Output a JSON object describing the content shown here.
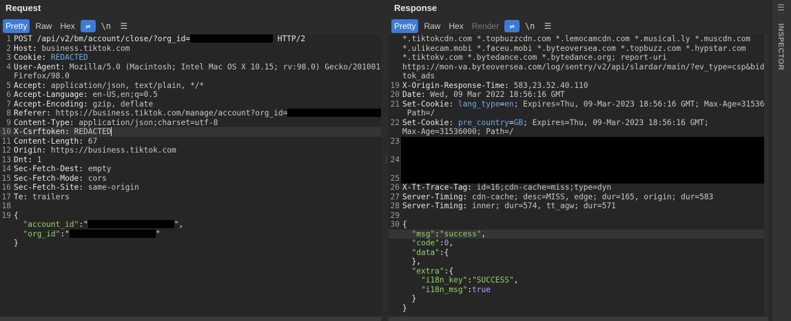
{
  "request": {
    "title": "Request",
    "tabs": [
      "Pretty",
      "Raw",
      "Hex"
    ],
    "newline_label": "\\n",
    "lines": [
      {
        "n": "1",
        "parts": [
          [
            "k",
            "POST /api/v2/bm/account/close/?org_id="
          ],
          [
            "redact",
            "120"
          ],
          [
            "k",
            " HTTP/2"
          ]
        ]
      },
      {
        "n": "2",
        "parts": [
          [
            "k",
            "Host: "
          ],
          [
            "v",
            "business.tiktok.com"
          ]
        ]
      },
      {
        "n": "3",
        "parts": [
          [
            "k",
            "Cookie: "
          ],
          [
            "blue",
            "REDACTED"
          ]
        ]
      },
      {
        "n": "4",
        "parts": [
          [
            "k",
            "User-Agent: "
          ],
          [
            "v",
            "Mozilla/5.0 (Macintosh; Intel Mac OS X 10.15; rv:98.0) Gecko/20100101"
          ]
        ]
      },
      {
        "n": "",
        "parts": [
          [
            "v",
            "Firefox/98.0"
          ]
        ]
      },
      {
        "n": "5",
        "parts": [
          [
            "k",
            "Accept: "
          ],
          [
            "v",
            "application/json, text/plain, */*"
          ]
        ]
      },
      {
        "n": "6",
        "parts": [
          [
            "k",
            "Accept-Language: "
          ],
          [
            "v",
            "en-US,en;q=0.5"
          ]
        ]
      },
      {
        "n": "7",
        "parts": [
          [
            "k",
            "Accept-Encoding: "
          ],
          [
            "v",
            "gzip, deflate"
          ]
        ]
      },
      {
        "n": "8",
        "parts": [
          [
            "k",
            "Referer: "
          ],
          [
            "v",
            "https://business.tiktok.com/manage/account?org_id="
          ],
          [
            "redact",
            "145"
          ]
        ]
      },
      {
        "n": "9",
        "parts": [
          [
            "k",
            "Content-Type: "
          ],
          [
            "v",
            "application/json;charset=utf-8"
          ]
        ]
      },
      {
        "n": "10",
        "hl": true,
        "parts": [
          [
            "k",
            "X-Csrftoken: "
          ],
          [
            "v",
            "REDACTED"
          ],
          [
            "cursor",
            ""
          ]
        ]
      },
      {
        "n": "11",
        "parts": [
          [
            "k",
            "Content-Length: "
          ],
          [
            "v",
            "67"
          ]
        ]
      },
      {
        "n": "12",
        "parts": [
          [
            "k",
            "Origin: "
          ],
          [
            "v",
            "https://business.tiktok.com"
          ]
        ]
      },
      {
        "n": "13",
        "parts": [
          [
            "k",
            "Dnt: "
          ],
          [
            "v",
            "1"
          ]
        ]
      },
      {
        "n": "14",
        "parts": [
          [
            "k",
            "Sec-Fetch-Dest: "
          ],
          [
            "v",
            "empty"
          ]
        ]
      },
      {
        "n": "15",
        "parts": [
          [
            "k",
            "Sec-Fetch-Mode: "
          ],
          [
            "v",
            "cors"
          ]
        ]
      },
      {
        "n": "16",
        "parts": [
          [
            "k",
            "Sec-Fetch-Site: "
          ],
          [
            "v",
            "same-origin"
          ]
        ]
      },
      {
        "n": "17",
        "parts": [
          [
            "k",
            "Te: "
          ],
          [
            "v",
            "trailers"
          ]
        ]
      },
      {
        "n": "18",
        "parts": []
      },
      {
        "n": "19",
        "parts": [
          [
            "k",
            "{"
          ]
        ]
      },
      {
        "n": "",
        "parts": [
          [
            "k",
            "  "
          ],
          [
            "str",
            "\"account_id\""
          ],
          [
            "k",
            ":\""
          ],
          [
            "redact",
            "125"
          ],
          [
            "k",
            "\","
          ]
        ]
      },
      {
        "n": "",
        "parts": [
          [
            "k",
            "  "
          ],
          [
            "str",
            "\"org_id\""
          ],
          [
            "k",
            ":\""
          ],
          [
            "redact",
            "125"
          ],
          [
            "k",
            "\""
          ]
        ]
      },
      {
        "n": "",
        "parts": [
          [
            "k",
            "}"
          ]
        ]
      }
    ]
  },
  "response": {
    "title": "Response",
    "tabs": [
      "Pretty",
      "Raw",
      "Hex",
      "Render"
    ],
    "newline_label": "\\n",
    "lines": [
      {
        "n": "",
        "parts": [
          [
            "v",
            "*.tiktokcdn.com *.topbuzzcdn.com *.lemocamcdn.com *.musical.ly *.muscdn.com"
          ]
        ]
      },
      {
        "n": "",
        "parts": [
          [
            "v",
            "*.ulikecam.mobi *.faceu.mobi *.byteoversea.com *.topbuzz.com *.hypstar.com"
          ]
        ]
      },
      {
        "n": "",
        "parts": [
          [
            "v",
            "*.tiktokv.com *.bytedance.com *.bytedance.org; report-uri"
          ]
        ]
      },
      {
        "n": "",
        "parts": [
          [
            "v",
            "https://mon-va.byteoversea.com/log/sentry/v2/api/slardar/main/?ev_type=csp&bid=tik"
          ]
        ]
      },
      {
        "n": "",
        "parts": [
          [
            "v",
            "tok_ads"
          ]
        ]
      },
      {
        "n": "19",
        "parts": [
          [
            "k",
            "X-Origin-Response-Time: "
          ],
          [
            "v",
            "583,23.52.40.110"
          ]
        ]
      },
      {
        "n": "20",
        "parts": [
          [
            "k",
            "Date: "
          ],
          [
            "v",
            "Wed, 09 Mar 2022 18:56:16 GMT"
          ]
        ]
      },
      {
        "n": "21",
        "parts": [
          [
            "k",
            "Set-Cookie: "
          ],
          [
            "blue",
            "lang_type"
          ],
          [
            "k",
            "="
          ],
          [
            "blue",
            "en"
          ],
          [
            "v",
            "; Expires=Thu, 09-Mar-2023 18:56:16 GMT; Max-Age=31536000;"
          ]
        ]
      },
      {
        "n": "",
        "parts": [
          [
            "v",
            " Path=/"
          ]
        ]
      },
      {
        "n": "22",
        "parts": [
          [
            "k",
            "Set-Cookie: "
          ],
          [
            "blue",
            "pre_country"
          ],
          [
            "k",
            "="
          ],
          [
            "blue",
            "GB"
          ],
          [
            "v",
            "; Expires=Thu, 09-Mar-2023 18:56:16 GMT;"
          ]
        ]
      },
      {
        "n": "",
        "parts": [
          [
            "v",
            "Max-Age=31536000; Path=/"
          ]
        ]
      },
      {
        "n": "23",
        "parts": []
      },
      {
        "n": "",
        "parts": []
      },
      {
        "n": "24",
        "parts": []
      },
      {
        "n": "",
        "parts": []
      },
      {
        "n": "25",
        "parts": []
      },
      {
        "n": "26",
        "parts": [
          [
            "k",
            "X-Tt-Trace-Tag: "
          ],
          [
            "v",
            "id=16;cdn-cache=miss;type=dyn"
          ]
        ]
      },
      {
        "n": "27",
        "parts": [
          [
            "k",
            "Server-Timing: "
          ],
          [
            "v",
            "cdn-cache; desc=MISS, edge; dur=165, origin; dur=583"
          ]
        ]
      },
      {
        "n": "28",
        "parts": [
          [
            "k",
            "Server-Timing: "
          ],
          [
            "v",
            "inner; dur=574, tt_agw; dur=571"
          ]
        ]
      },
      {
        "n": "29",
        "parts": []
      },
      {
        "n": "30",
        "parts": [
          [
            "k",
            "{"
          ]
        ]
      },
      {
        "n": "",
        "hl": true,
        "parts": [
          [
            "k",
            "  "
          ],
          [
            "str",
            "\"msg\""
          ],
          [
            "k",
            ":"
          ],
          [
            "str",
            "\"success\""
          ],
          [
            "k",
            ","
          ]
        ]
      },
      {
        "n": "",
        "parts": [
          [
            "k",
            "  "
          ],
          [
            "str",
            "\"code\""
          ],
          [
            "k",
            ":"
          ],
          [
            "num",
            "0"
          ],
          [
            "k",
            ","
          ]
        ]
      },
      {
        "n": "",
        "parts": [
          [
            "k",
            "  "
          ],
          [
            "str",
            "\"data\""
          ],
          [
            "k",
            ":{"
          ]
        ]
      },
      {
        "n": "",
        "parts": [
          [
            "k",
            "  },"
          ]
        ]
      },
      {
        "n": "",
        "parts": [
          [
            "k",
            "  "
          ],
          [
            "str",
            "\"extra\""
          ],
          [
            "k",
            ":{"
          ]
        ]
      },
      {
        "n": "",
        "parts": [
          [
            "k",
            "    "
          ],
          [
            "str",
            "\"i18n_key\""
          ],
          [
            "k",
            ":"
          ],
          [
            "str",
            "\"SUCCESS\""
          ],
          [
            "k",
            ","
          ]
        ]
      },
      {
        "n": "",
        "parts": [
          [
            "k",
            "    "
          ],
          [
            "str",
            "\"i18n_msg\""
          ],
          [
            "k",
            ":"
          ],
          [
            "num",
            "true"
          ]
        ]
      },
      {
        "n": "",
        "parts": [
          [
            "k",
            "  }"
          ]
        ]
      },
      {
        "n": "",
        "parts": [
          [
            "k",
            "}"
          ]
        ]
      }
    ]
  },
  "inspector": {
    "label": "INSPECTOR"
  }
}
